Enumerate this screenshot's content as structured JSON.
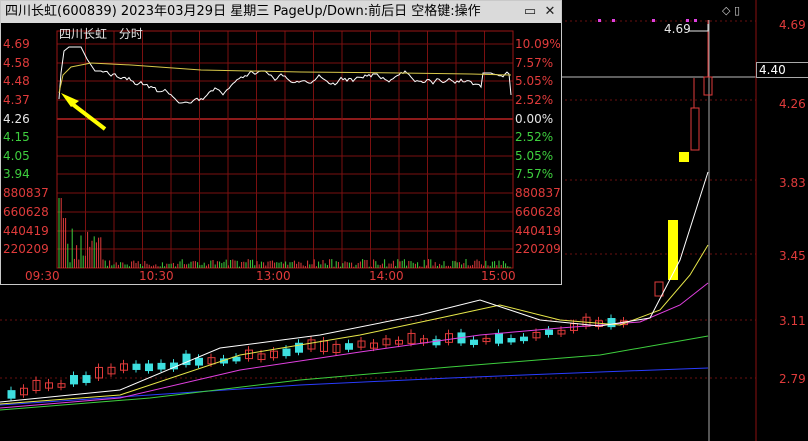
{
  "window": {
    "title": "四川长虹(600839) 2023年03月29日 星期三 PageUp/Down:前后日 空格键:操作",
    "min_icon": "minimize-icon",
    "close_icon": "close-icon"
  },
  "intraday": {
    "stock_name": "四川长虹",
    "mode_label": "分时",
    "price_labels": [
      "4.69",
      "4.58",
      "4.48",
      "4.37",
      "4.26",
      "4.15",
      "4.05",
      "3.94"
    ],
    "pct_labels": [
      "10.09%",
      "7.57%",
      "5.05%",
      "2.52%",
      "0.00%",
      "2.52%",
      "5.05%",
      "7.57%"
    ],
    "volume_labels": [
      "880837",
      "660628",
      "440419",
      "220209"
    ],
    "time_labels": [
      "09:30",
      "10:30",
      "13:00",
      "14:00",
      "15:00"
    ],
    "colors": {
      "up": "#e03b3b",
      "down": "#3ecf3e",
      "flat": "#e6e6e6",
      "price_line": "#ffffff",
      "avg_line": "#d8c84a",
      "grid": "#7a1010"
    }
  },
  "kline": {
    "right_axis_labels": [
      "4.69",
      "4.26",
      "3.83",
      "3.45",
      "3.11",
      "2.79"
    ],
    "current_price_box": "4.40",
    "peak_label": "4.69",
    "colors": {
      "up_candle": "#e03b3b",
      "down_candle": "#3ee0e0",
      "ma5": "#ffffff",
      "ma10": "#e8e84a",
      "ma20": "#e040e0",
      "ma30": "#3ecf3e",
      "ma60": "#2a3cff",
      "highlight": "#ffff00",
      "marker_dots": "#e040e0"
    }
  },
  "annotation": {
    "arrow": "arrow-icon",
    "arrow_color": "#ffff00"
  }
}
